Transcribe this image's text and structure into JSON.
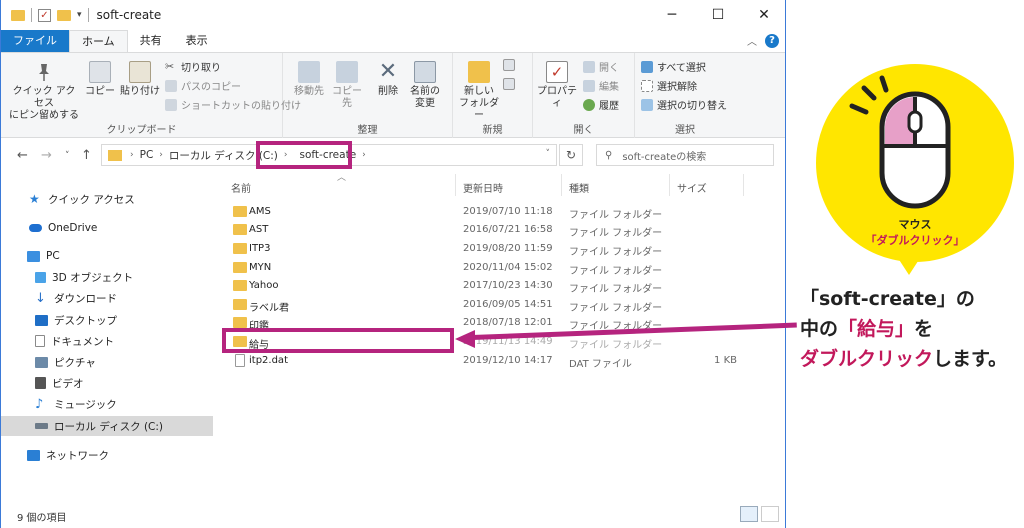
{
  "window": {
    "title": "soft-create",
    "controls": {
      "minimize": "─",
      "maximize": "☐",
      "close": "✕"
    }
  },
  "tabs": [
    {
      "label": "ファイル"
    },
    {
      "label": "ホーム"
    },
    {
      "label": "共有"
    },
    {
      "label": "表示"
    }
  ],
  "ribbon": {
    "clipboard": {
      "group_label": "クリップボード",
      "pin_label_1": "クイック アクセス",
      "pin_label_2": "にピン留めする",
      "copy_label": "コピー",
      "paste_label": "貼り付け",
      "cut_label": "切り取り",
      "copy_path_label": "パスのコピー",
      "paste_shortcut_label": "ショートカットの貼り付け"
    },
    "organize": {
      "group_label": "整理",
      "move_label": "移動先",
      "copy_to_label": "コピー先",
      "delete_label": "削除",
      "rename_label_1": "名前の",
      "rename_label_2": "変更"
    },
    "new": {
      "group_label": "新規",
      "new_folder_label_1": "新しい",
      "new_folder_label_2": "フォルダー"
    },
    "open": {
      "group_label": "開く",
      "properties_label": "プロパティ",
      "open_label": "開く",
      "edit_label": "編集",
      "history_label": "履歴"
    },
    "select": {
      "group_label": "選択",
      "select_all_label": "すべて選択",
      "select_none_label": "選択解除",
      "invert_label": "選択の切り替え"
    }
  },
  "address": {
    "segments": [
      "PC",
      "ローカル ディスク (C:)",
      "soft-create"
    ],
    "search_placeholder": "soft-createの検索"
  },
  "nav": {
    "items": [
      {
        "label": "クイック アクセス",
        "icon": "star-icon",
        "color": "#2a7fd4"
      },
      {
        "label": "OneDrive",
        "icon": "cloud-icon",
        "color": "#1e6fd0"
      },
      {
        "label": "PC",
        "icon": "monitor-icon",
        "color": "#3b8fe0"
      },
      {
        "label": "3D オブジェクト",
        "icon": "cube-icon",
        "color": "#4aa3e8"
      },
      {
        "label": "ダウンロード",
        "icon": "download-icon",
        "color": "#2a72c9"
      },
      {
        "label": "デスクトップ",
        "icon": "desktop-icon",
        "color": "#1f6ec6"
      },
      {
        "label": "ドキュメント",
        "icon": "document-icon",
        "color": "#8a8a8a"
      },
      {
        "label": "ピクチャ",
        "icon": "picture-icon",
        "color": "#6c8aa8"
      },
      {
        "label": "ビデオ",
        "icon": "video-icon",
        "color": "#555555"
      },
      {
        "label": "ミュージック",
        "icon": "music-icon",
        "color": "#2a7fd4"
      },
      {
        "label": "ローカル ディスク (C:)",
        "icon": "drive-icon",
        "color": "#6c7a88"
      },
      {
        "label": "ネットワーク",
        "icon": "network-icon",
        "color": "#2a7fd4"
      }
    ]
  },
  "columns": {
    "name": "名前",
    "date": "更新日時",
    "type": "種類",
    "size": "サイズ"
  },
  "files": [
    {
      "name": "AMS",
      "date": "2019/07/10 11:18",
      "type": "ファイル フォルダー",
      "size": "",
      "kind": "folder"
    },
    {
      "name": "AST",
      "date": "2016/07/21 16:58",
      "type": "ファイル フォルダー",
      "size": "",
      "kind": "folder"
    },
    {
      "name": "ITP3",
      "date": "2019/08/20 11:59",
      "type": "ファイル フォルダー",
      "size": "",
      "kind": "folder"
    },
    {
      "name": "MYN",
      "date": "2020/11/04 15:02",
      "type": "ファイル フォルダー",
      "size": "",
      "kind": "folder"
    },
    {
      "name": "Yahoo",
      "date": "2017/10/23 14:30",
      "type": "ファイル フォルダー",
      "size": "",
      "kind": "folder"
    },
    {
      "name": "ラベル君",
      "date": "2016/09/05 14:51",
      "type": "ファイル フォルダー",
      "size": "",
      "kind": "folder"
    },
    {
      "name": "印鑑",
      "date": "2018/07/18 12:01",
      "type": "ファイル フォルダー",
      "size": "",
      "kind": "folder"
    },
    {
      "name": "給与",
      "date": "2019/11/13 14:49",
      "type": "ファイル フォルダー",
      "size": "",
      "kind": "folder"
    },
    {
      "name": "itp2.dat",
      "date": "2019/12/10 14:17",
      "type": "DAT ファイル",
      "size": "1 KB",
      "kind": "file"
    }
  ],
  "status": {
    "count": "9 個の項目"
  },
  "callout": {
    "mouse_label": "マウス",
    "mouse_action": "「ダブルクリック」",
    "line1_a": "「soft-create」の",
    "line2_a": "中の",
    "line2_b": "「給与」",
    "line2_c": "を",
    "line3_a": "ダブルクリック",
    "line3_b": "します。"
  },
  "colors": {
    "highlight": "#b5247e",
    "bubble": "#ffe600",
    "accent": "#1979ca"
  }
}
